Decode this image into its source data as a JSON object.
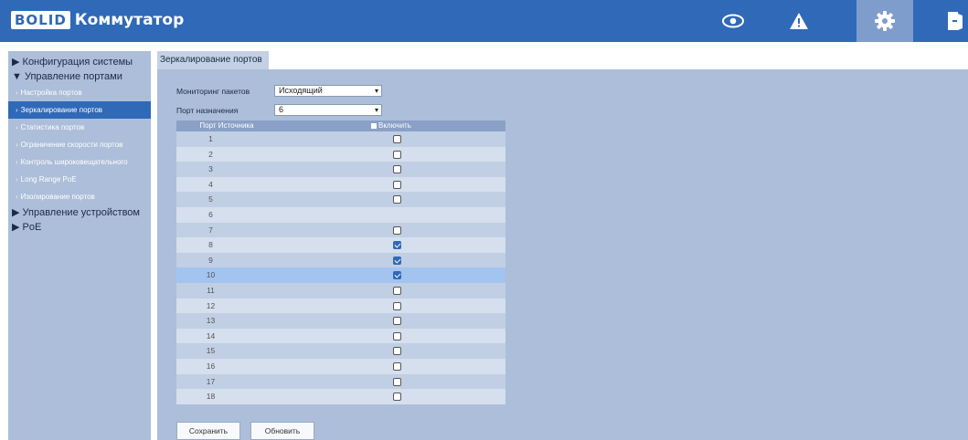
{
  "header": {
    "logo": "BOLID",
    "title": "Коммутатор",
    "icons": [
      "eye-icon",
      "warning-icon",
      "gear-icon",
      "exit-icon"
    ],
    "colors": {
      "bar": "#2f69b7",
      "active_icon_bg": "#7f9dcc"
    }
  },
  "sidebar": {
    "sections": [
      {
        "label": "Конфигурация системы",
        "expanded": false
      },
      {
        "label": "Управление портами",
        "expanded": true
      },
      {
        "label": "Управление устройством",
        "expanded": false
      },
      {
        "label": "PoE",
        "expanded": false
      }
    ],
    "items": [
      {
        "label": "Настройка портов"
      },
      {
        "label": "Зеркалирование портов",
        "active": true
      },
      {
        "label": "Статистика портов"
      },
      {
        "label": "Ограничение скорости портов"
      },
      {
        "label": "Контроль широковещательного"
      },
      {
        "label": "Long Range PoE"
      },
      {
        "label": "Изолирование портов"
      }
    ]
  },
  "tab": {
    "label": "Зеркалирование портов"
  },
  "form": {
    "monitoring_label": "Мониторинг пакетов",
    "monitoring_value": "Исходящий",
    "dest_label": "Порт назначения",
    "dest_value": "6"
  },
  "table": {
    "col_source": "Порт Источника",
    "col_enable": "Включить",
    "rows": [
      {
        "port": "1",
        "checked": false
      },
      {
        "port": "2",
        "checked": false
      },
      {
        "port": "3",
        "checked": false
      },
      {
        "port": "4",
        "checked": false
      },
      {
        "port": "5",
        "checked": false
      },
      {
        "port": "6",
        "checked": false,
        "disabled": true
      },
      {
        "port": "7",
        "checked": false
      },
      {
        "port": "8",
        "checked": true
      },
      {
        "port": "9",
        "checked": true
      },
      {
        "port": "10",
        "checked": true,
        "highlighted": true
      },
      {
        "port": "11",
        "checked": false
      },
      {
        "port": "12",
        "checked": false
      },
      {
        "port": "13",
        "checked": false
      },
      {
        "port": "14",
        "checked": false
      },
      {
        "port": "15",
        "checked": false
      },
      {
        "port": "16",
        "checked": false
      },
      {
        "port": "17",
        "checked": false
      },
      {
        "port": "18",
        "checked": false
      }
    ]
  },
  "buttons": {
    "save": "Сохранить",
    "refresh": "Обновить"
  }
}
